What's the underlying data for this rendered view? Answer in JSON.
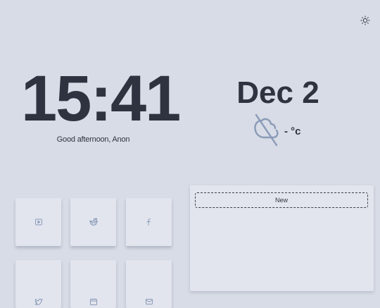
{
  "header": {
    "theme_toggle_icon": "sun-icon"
  },
  "clock": {
    "time": "15:41",
    "greeting": "Good afternoon, Anon"
  },
  "date": {
    "text": "Dec 2"
  },
  "weather": {
    "icon": "cloud-off-icon",
    "temperature": "- °c"
  },
  "shortcuts": [
    {
      "icon": "youtube-icon"
    },
    {
      "icon": "reddit-icon"
    },
    {
      "icon": "facebook-icon"
    },
    {
      "icon": "twitter-icon"
    },
    {
      "icon": "calendar-icon"
    },
    {
      "icon": "mail-icon"
    }
  ],
  "notes": {
    "new_label": "New"
  },
  "colors": {
    "background": "#d8dce6",
    "tile": "#e2e5ee",
    "text": "#2f3340",
    "icon_accent": "#8a9bb8"
  }
}
